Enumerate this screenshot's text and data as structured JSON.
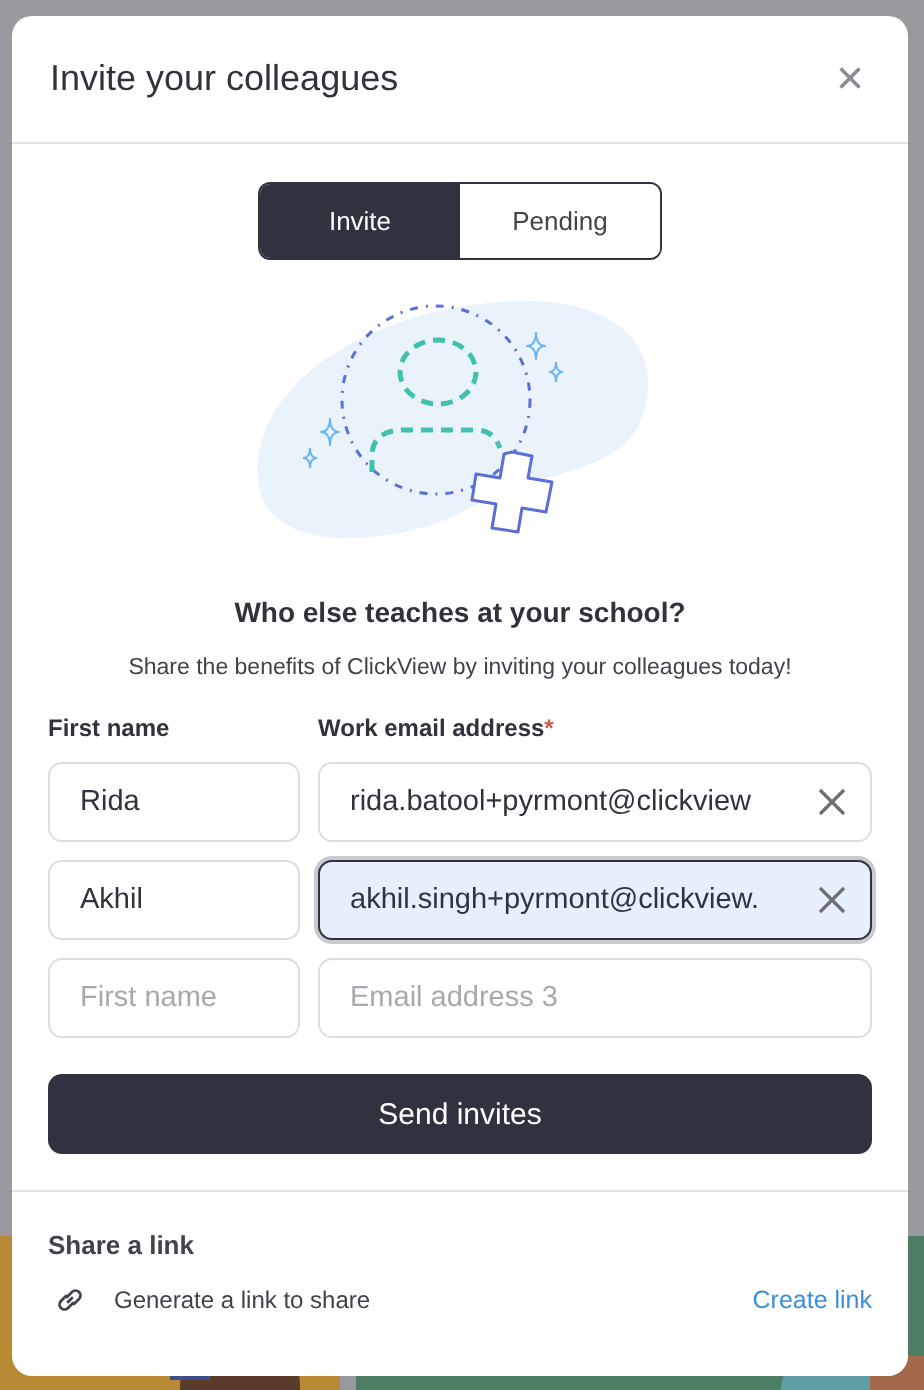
{
  "dialog": {
    "title": "Invite your colleagues",
    "close": "×"
  },
  "tabs": [
    {
      "label": "Invite",
      "selected": true
    },
    {
      "label": "Pending",
      "selected": false
    }
  ],
  "heading": "Who else teaches at your school?",
  "subtitle": "Share the benefits of ClickView by inviting your colleagues today!",
  "columns": {
    "first_name": "First name",
    "email": "Work email address",
    "required_mark": "*"
  },
  "rows": [
    {
      "first_name": {
        "value": "Rida"
      },
      "email": {
        "value": "rida.batool+pyrmont@clickview",
        "focused": false
      }
    },
    {
      "first_name": {
        "value": "Akhil"
      },
      "email": {
        "value": "akhil.singh+pyrmont@clickview.",
        "focused": true
      }
    },
    {
      "first_name": {
        "placeholder": "First name"
      },
      "email": {
        "placeholder": "Email address 3",
        "focused": false
      }
    }
  ],
  "send_button": "Send invites",
  "share": {
    "title": "Share a link",
    "description": "Generate a link to share",
    "action": "Create link"
  }
}
